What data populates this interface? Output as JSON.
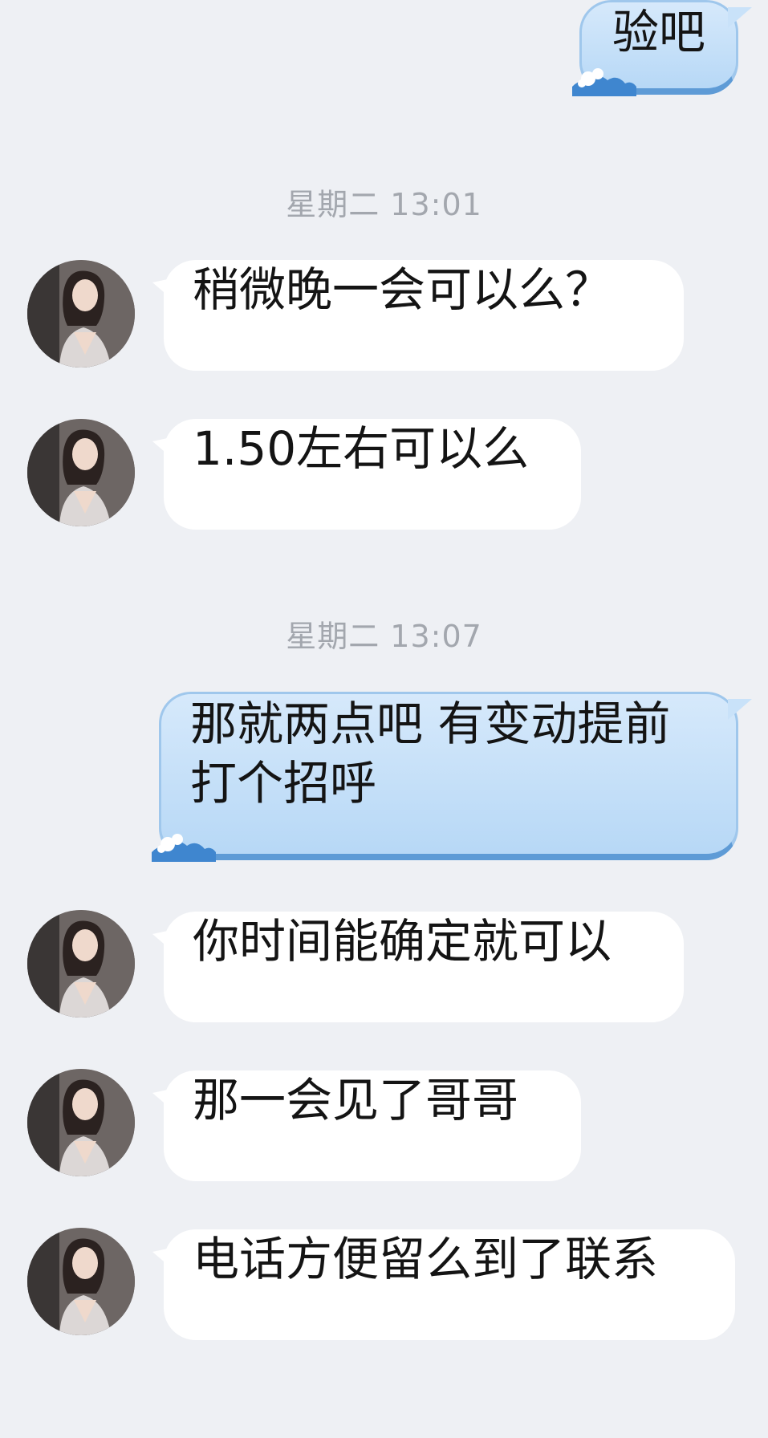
{
  "timestamps": [
    "星期二 13:01",
    "星期二 13:07"
  ],
  "messages": {
    "m1": "验吧",
    "m2": "稍微晚一会可以么？",
    "m3": "1.50左右可以么",
    "m4": "那就两点吧 有变动提前打个招呼",
    "m5": "你时间能确定就可以",
    "m6": "那一会见了哥哥",
    "m7": "电话方便留么到了联系"
  },
  "colors": {
    "background": "#eef0f4",
    "incoming_bubble": "#ffffff",
    "outgoing_bubble": "#c3def7",
    "timestamp": "#a3a7ae"
  }
}
